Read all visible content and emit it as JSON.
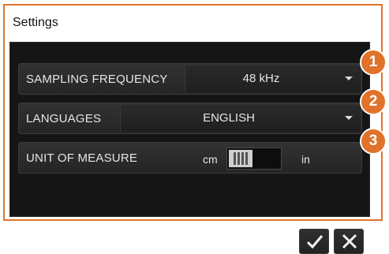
{
  "window": {
    "title": "Settings"
  },
  "settings": {
    "sampling_frequency": {
      "label": "SAMPLING FREQUENCY",
      "value": "48 kHz"
    },
    "languages": {
      "label": "LANGUAGES",
      "value": "ENGLISH"
    },
    "unit_of_measure": {
      "label": "UNIT OF MEASURE",
      "left_option": "cm",
      "right_option": "in",
      "selected": "cm"
    }
  },
  "callouts": [
    "1",
    "2",
    "3"
  ],
  "buttons": {
    "confirm_icon": "check-icon",
    "cancel_icon": "close-icon"
  },
  "colors": {
    "accent": "#e0722a",
    "panel": "#151515",
    "row": "#2c2c2c",
    "text": "#e6e6e6"
  }
}
